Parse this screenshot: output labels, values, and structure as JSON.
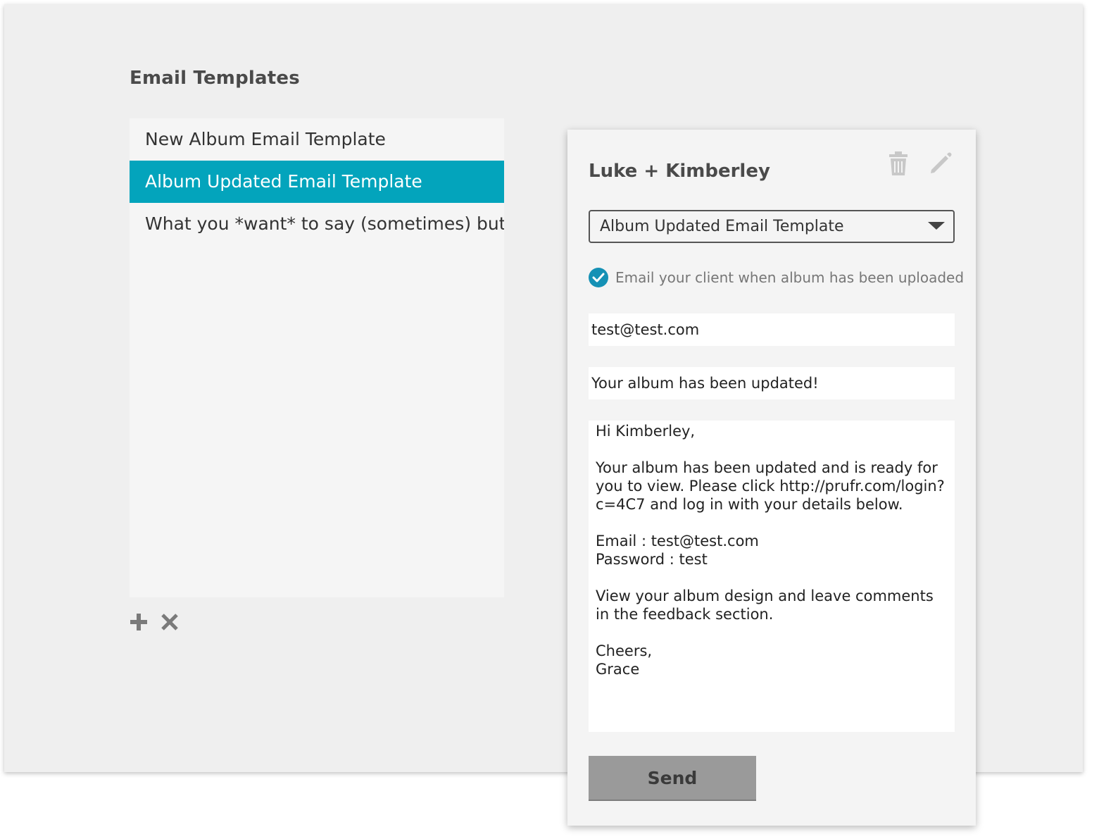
{
  "page": {
    "section_title": "Email Templates"
  },
  "templates": {
    "items": [
      {
        "label": "New Album Email Template"
      },
      {
        "label": "Album Updated Email Template"
      },
      {
        "label": "What you *want* to say (sometimes) but ..."
      }
    ],
    "selected_index": 1,
    "add_icon": "plus-icon",
    "remove_icon": "close-icon"
  },
  "composer": {
    "title": "Luke + Kimberley",
    "delete_icon": "trash-icon",
    "edit_icon": "pencil-icon",
    "template_select": {
      "value": "Album Updated Email Template"
    },
    "notify_checkbox": {
      "checked": true,
      "label": "Email your client when album has been uploaded"
    },
    "to_email": "test@test.com",
    "subject": "Your album has been updated!",
    "body": "Hi Kimberley,\n\nYour album has been updated and is ready for you to view. Please click http://prufr.com/login?c=4C7 and log in with your details below.\n\nEmail : test@test.com\nPassword : test\n\nView your album design and leave comments in the feedback section.\n\nCheers,\nGrace",
    "send_label": "Send"
  },
  "colors": {
    "accent": "#03a4bc",
    "check": "#1591b5",
    "send_button": "#9a9a9a",
    "background": "#efefef"
  }
}
